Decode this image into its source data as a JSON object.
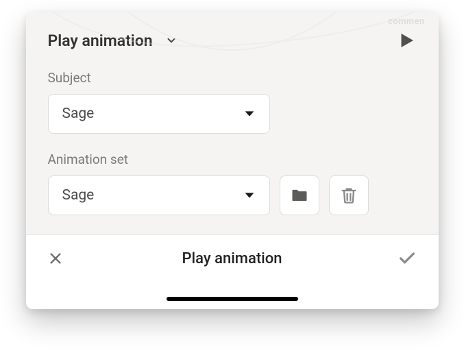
{
  "header": {
    "title": "Play animation",
    "chevron": "chevron-down"
  },
  "play": {
    "icon": "play"
  },
  "fields": {
    "subject": {
      "label": "Subject",
      "value": "Sage"
    },
    "animationSet": {
      "label": "Animation set",
      "value": "Sage"
    }
  },
  "actions": {
    "folder": "folder",
    "delete": "trash"
  },
  "footer": {
    "title": "Play animation",
    "cancel": "close",
    "confirm": "check"
  },
  "hint": "commen"
}
